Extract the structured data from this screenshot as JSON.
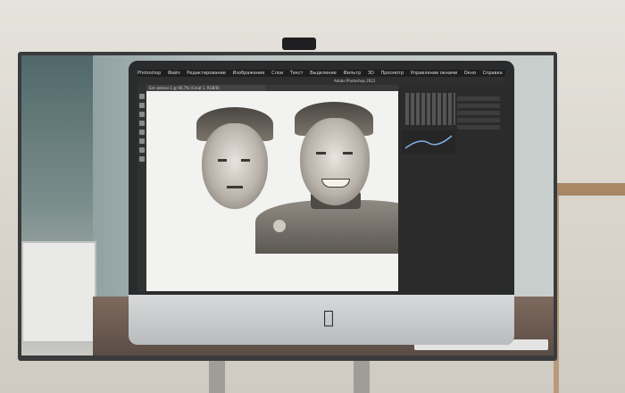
{
  "scene": {
    "description_label": "",
    "apple_glyph": ""
  },
  "photoshop": {
    "menu": [
      "Photoshop",
      "Файл",
      "Редактирование",
      "Изображение",
      "Слои",
      "Текст",
      "Выделение",
      "Фильтр",
      "3D",
      "Просмотр",
      "Управление окнами",
      "Окно",
      "Справка"
    ],
    "window_title": "Adobe Photoshop 2022",
    "document_tab": "Без имени-1 @ 66,7% (Слой 1, RGB/8)"
  },
  "colors": {
    "tv_bezel": "#3a3b3d",
    "ps_background": "#39393b",
    "canvas": "#f2f2f0"
  }
}
